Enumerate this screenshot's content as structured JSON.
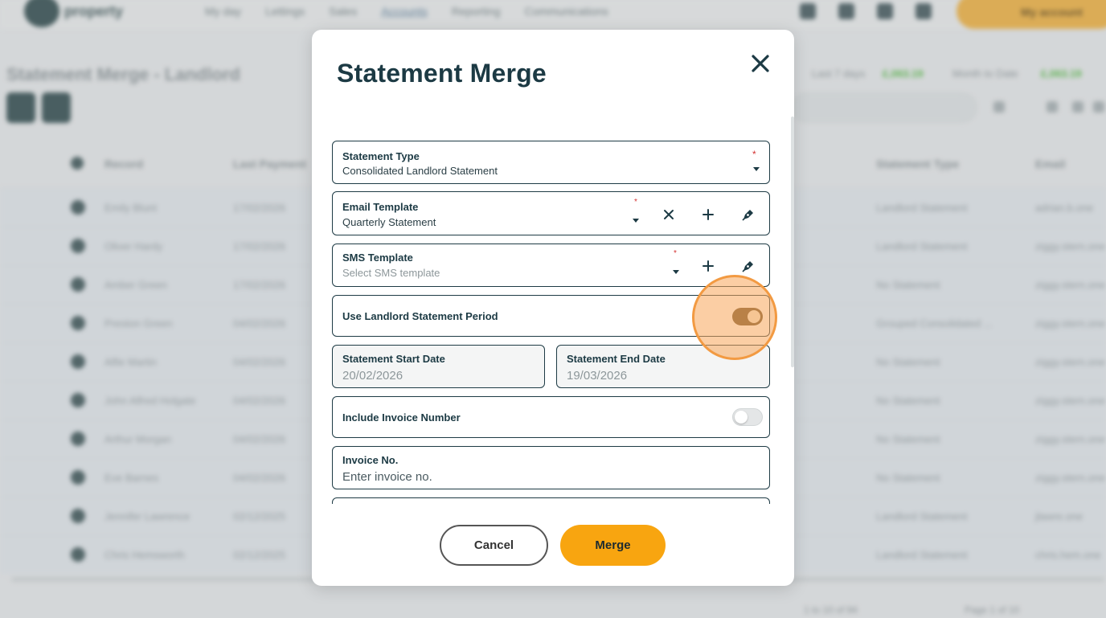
{
  "background": {
    "logo_text": "property",
    "nav": [
      "My day",
      "Lettings",
      "Sales",
      "Accounts",
      "Reporting",
      "Communications"
    ],
    "account_label": "My account",
    "page_title": "Statement Merge - Landlord",
    "stats": [
      {
        "label": "Last 7 days",
        "value": "£,063.19"
      },
      {
        "label": "Month to Date",
        "value": "£,063.19"
      }
    ],
    "table": {
      "headers": [
        "Record",
        "Last Payment",
        "Statement Type",
        "Email"
      ],
      "rows": [
        {
          "name": "Emily Blunt",
          "date": "17/02/2026",
          "type": "Landlord Statement",
          "email": "adrian.b.one"
        },
        {
          "name": "Oliver Hardy",
          "date": "17/02/2026",
          "type": "Landlord Statement",
          "email": "ziggy.stern.one"
        },
        {
          "name": "Amber Green",
          "date": "17/02/2026",
          "type": "No Statement",
          "email": "ziggy.stern.one"
        },
        {
          "name": "Preston Green",
          "date": "04/02/2026",
          "type": "Grouped Consolidated ...",
          "email": "ziggy.stern.one"
        },
        {
          "name": "Alfie Martin",
          "date": "04/02/2026",
          "type": "No Statement",
          "email": "ziggy.stern.one"
        },
        {
          "name": "John Alfred Holgate",
          "date": "04/02/2026",
          "type": "No Statement",
          "email": "ziggy.stern.one"
        },
        {
          "name": "Arthur Morgan",
          "date": "04/02/2026",
          "type": "No Statement",
          "email": "ziggy.stern.one"
        },
        {
          "name": "Eve Barnes",
          "date": "04/02/2026",
          "type": "No Statement",
          "email": "ziggy.stern.one"
        },
        {
          "name": "Jennifer Lawrence",
          "date": "02/12/2025",
          "type": "Landlord Statement",
          "email": "jlawre.one"
        },
        {
          "name": "Chris Hemsworth",
          "date": "02/12/2025",
          "type": "Landlord Statement",
          "email": "chris.hem.one"
        }
      ]
    },
    "footer": {
      "count": "1 to 10 of 94",
      "page": "Page 1 of 10"
    }
  },
  "modal": {
    "title": "Statement Merge",
    "statement_type": {
      "label": "Statement Type",
      "value": "Consolidated Landlord Statement",
      "required": "*"
    },
    "email_template": {
      "label": "Email Template",
      "value": "Quarterly Statement",
      "required": "*"
    },
    "sms_template": {
      "label": "SMS Template",
      "placeholder": "Select SMS template",
      "required": "*"
    },
    "use_period": {
      "label": "Use Landlord Statement Period",
      "on": true
    },
    "start_date": {
      "label": "Statement Start Date",
      "value": "20/02/2026"
    },
    "end_date": {
      "label": "Statement End Date",
      "value": "19/03/2026"
    },
    "include_invoice": {
      "label": "Include Invoice Number",
      "on": false
    },
    "invoice_no": {
      "label": "Invoice No.",
      "placeholder": "Enter invoice no."
    },
    "cancel_label": "Cancel",
    "merge_label": "Merge"
  },
  "colors": {
    "accent": "#f8a510",
    "primary": "#1c3a44",
    "toggle_on": "#6e5432",
    "highlight": "#f29a42"
  }
}
